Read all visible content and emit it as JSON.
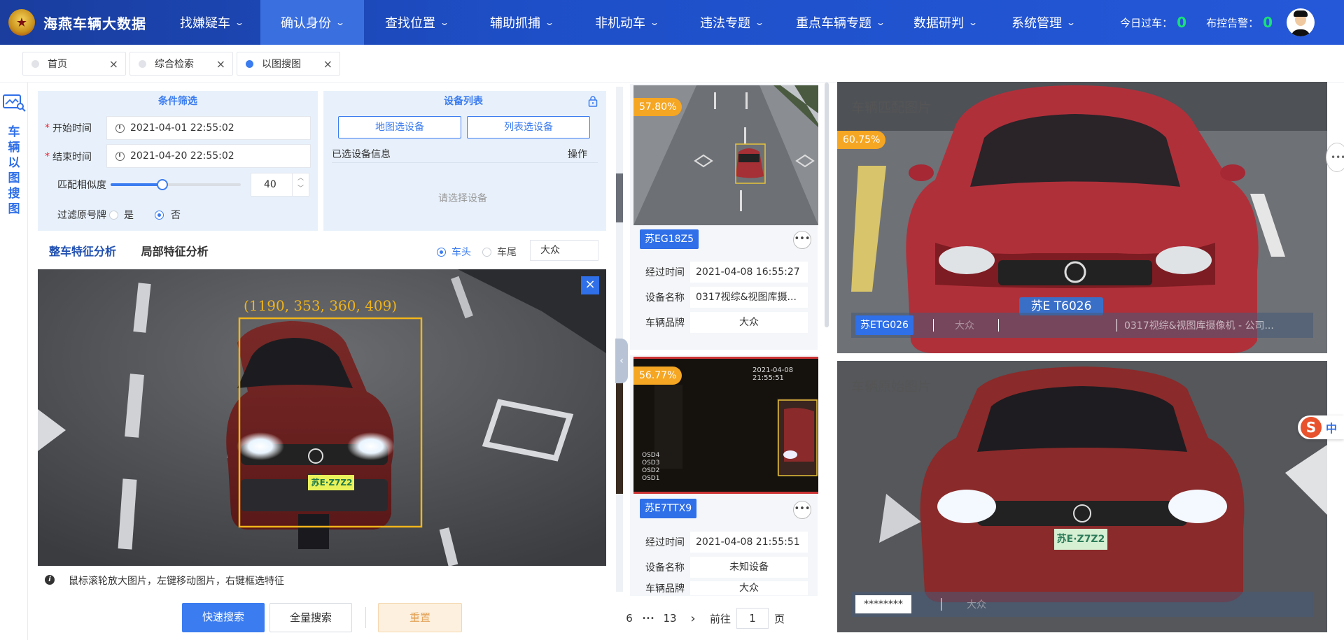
{
  "app": {
    "title": "海燕车辆大数据"
  },
  "nav": {
    "items": [
      {
        "label": "找嫌疑车"
      },
      {
        "label": "确认身份"
      },
      {
        "label": "查找位置"
      },
      {
        "label": "辅助抓捕"
      },
      {
        "label": "非机动车"
      },
      {
        "label": "违法专题"
      },
      {
        "label": "重点车辆专题"
      },
      {
        "label": "数据研判"
      },
      {
        "label": "系统管理"
      }
    ],
    "chev": "⌄",
    "today_label": "今日过车：",
    "today_value": "0",
    "alarm_label": "布控告警：",
    "alarm_value": "0"
  },
  "tabs": [
    {
      "label": "首页"
    },
    {
      "label": "综合检索"
    },
    {
      "label": "以图搜图"
    }
  ],
  "sidebar": {
    "label": "车辆以图搜图"
  },
  "conditions": {
    "title": "条件筛选",
    "start_label": "开始时间",
    "start_value": "2021-04-01 22:55:02",
    "end_label": "结束时间",
    "end_value": "2021-04-20 22:55:02",
    "similarity_label": "匹配相似度",
    "similarity_value": "40",
    "similarity_fraction": 0.4,
    "filter_label": "过滤原号牌",
    "filter_yes": "是",
    "filter_no": "否"
  },
  "devices": {
    "title": "设备列表",
    "map_btn": "地图选设备",
    "list_btn": "列表选设备",
    "selected_label": "已选设备信息",
    "op_label": "操作",
    "empty": "请选择设备"
  },
  "analysis": {
    "tab_whole": "整车特征分析",
    "tab_local": "局部特征分析",
    "opt_front": "车头",
    "opt_rear": "车尾",
    "brand_value": "大众",
    "bbox_text": "(1190, 353, 360, 409)",
    "plate_text": "苏E·Z7Z2",
    "hint": "鼠标滚轮放大图片，左键移动图片，右键框选特征"
  },
  "buttons": {
    "quick": "快速搜索",
    "full": "全量搜索",
    "reset": "重置"
  },
  "results": [
    {
      "pct": "57.80%",
      "plate": "苏EG18Z5",
      "time_label": "经过时间",
      "time": "2021-04-08 16:55:27",
      "device_label": "设备名称",
      "device": "0317视综&视图库摄...",
      "brand_label": "车辆品牌",
      "brand": "大众"
    },
    {
      "pct": "56.77%",
      "plate": "苏E7TTX9",
      "overlay": "2021-04-08 21:55:51",
      "osd": [
        "OSD4",
        "OSD3",
        "OSD2",
        "OSD1"
      ],
      "time_label": "经过时间",
      "time": "2021-04-08 21:55:51",
      "device_label": "设备名称",
      "device": "未知设备",
      "brand_label": "车辆品牌",
      "brand": "大众"
    }
  ],
  "pagination": {
    "p6": "6",
    "ellipsis": "•••",
    "p13": "13",
    "next": "›",
    "goto": "前往",
    "page_value": "1",
    "page_suffix": "页"
  },
  "match": {
    "label": "车辆匹配图片",
    "pct": "60.75%",
    "plate": "苏ETG026",
    "plate_on_car": "苏E T6026",
    "brand": "大众",
    "device": "0317视综&视图库摄像机 - 公司..."
  },
  "original": {
    "label": "车辆原始图片",
    "plate": "********",
    "brand": "大众",
    "plate_on_car": "苏E·Z7Z2"
  },
  "ime": {
    "label": "中"
  },
  "colors": {
    "accent": "#3b7cf0",
    "nav": "#1e4fc8",
    "pct": "#f5a623",
    "green": "#19e07a"
  }
}
